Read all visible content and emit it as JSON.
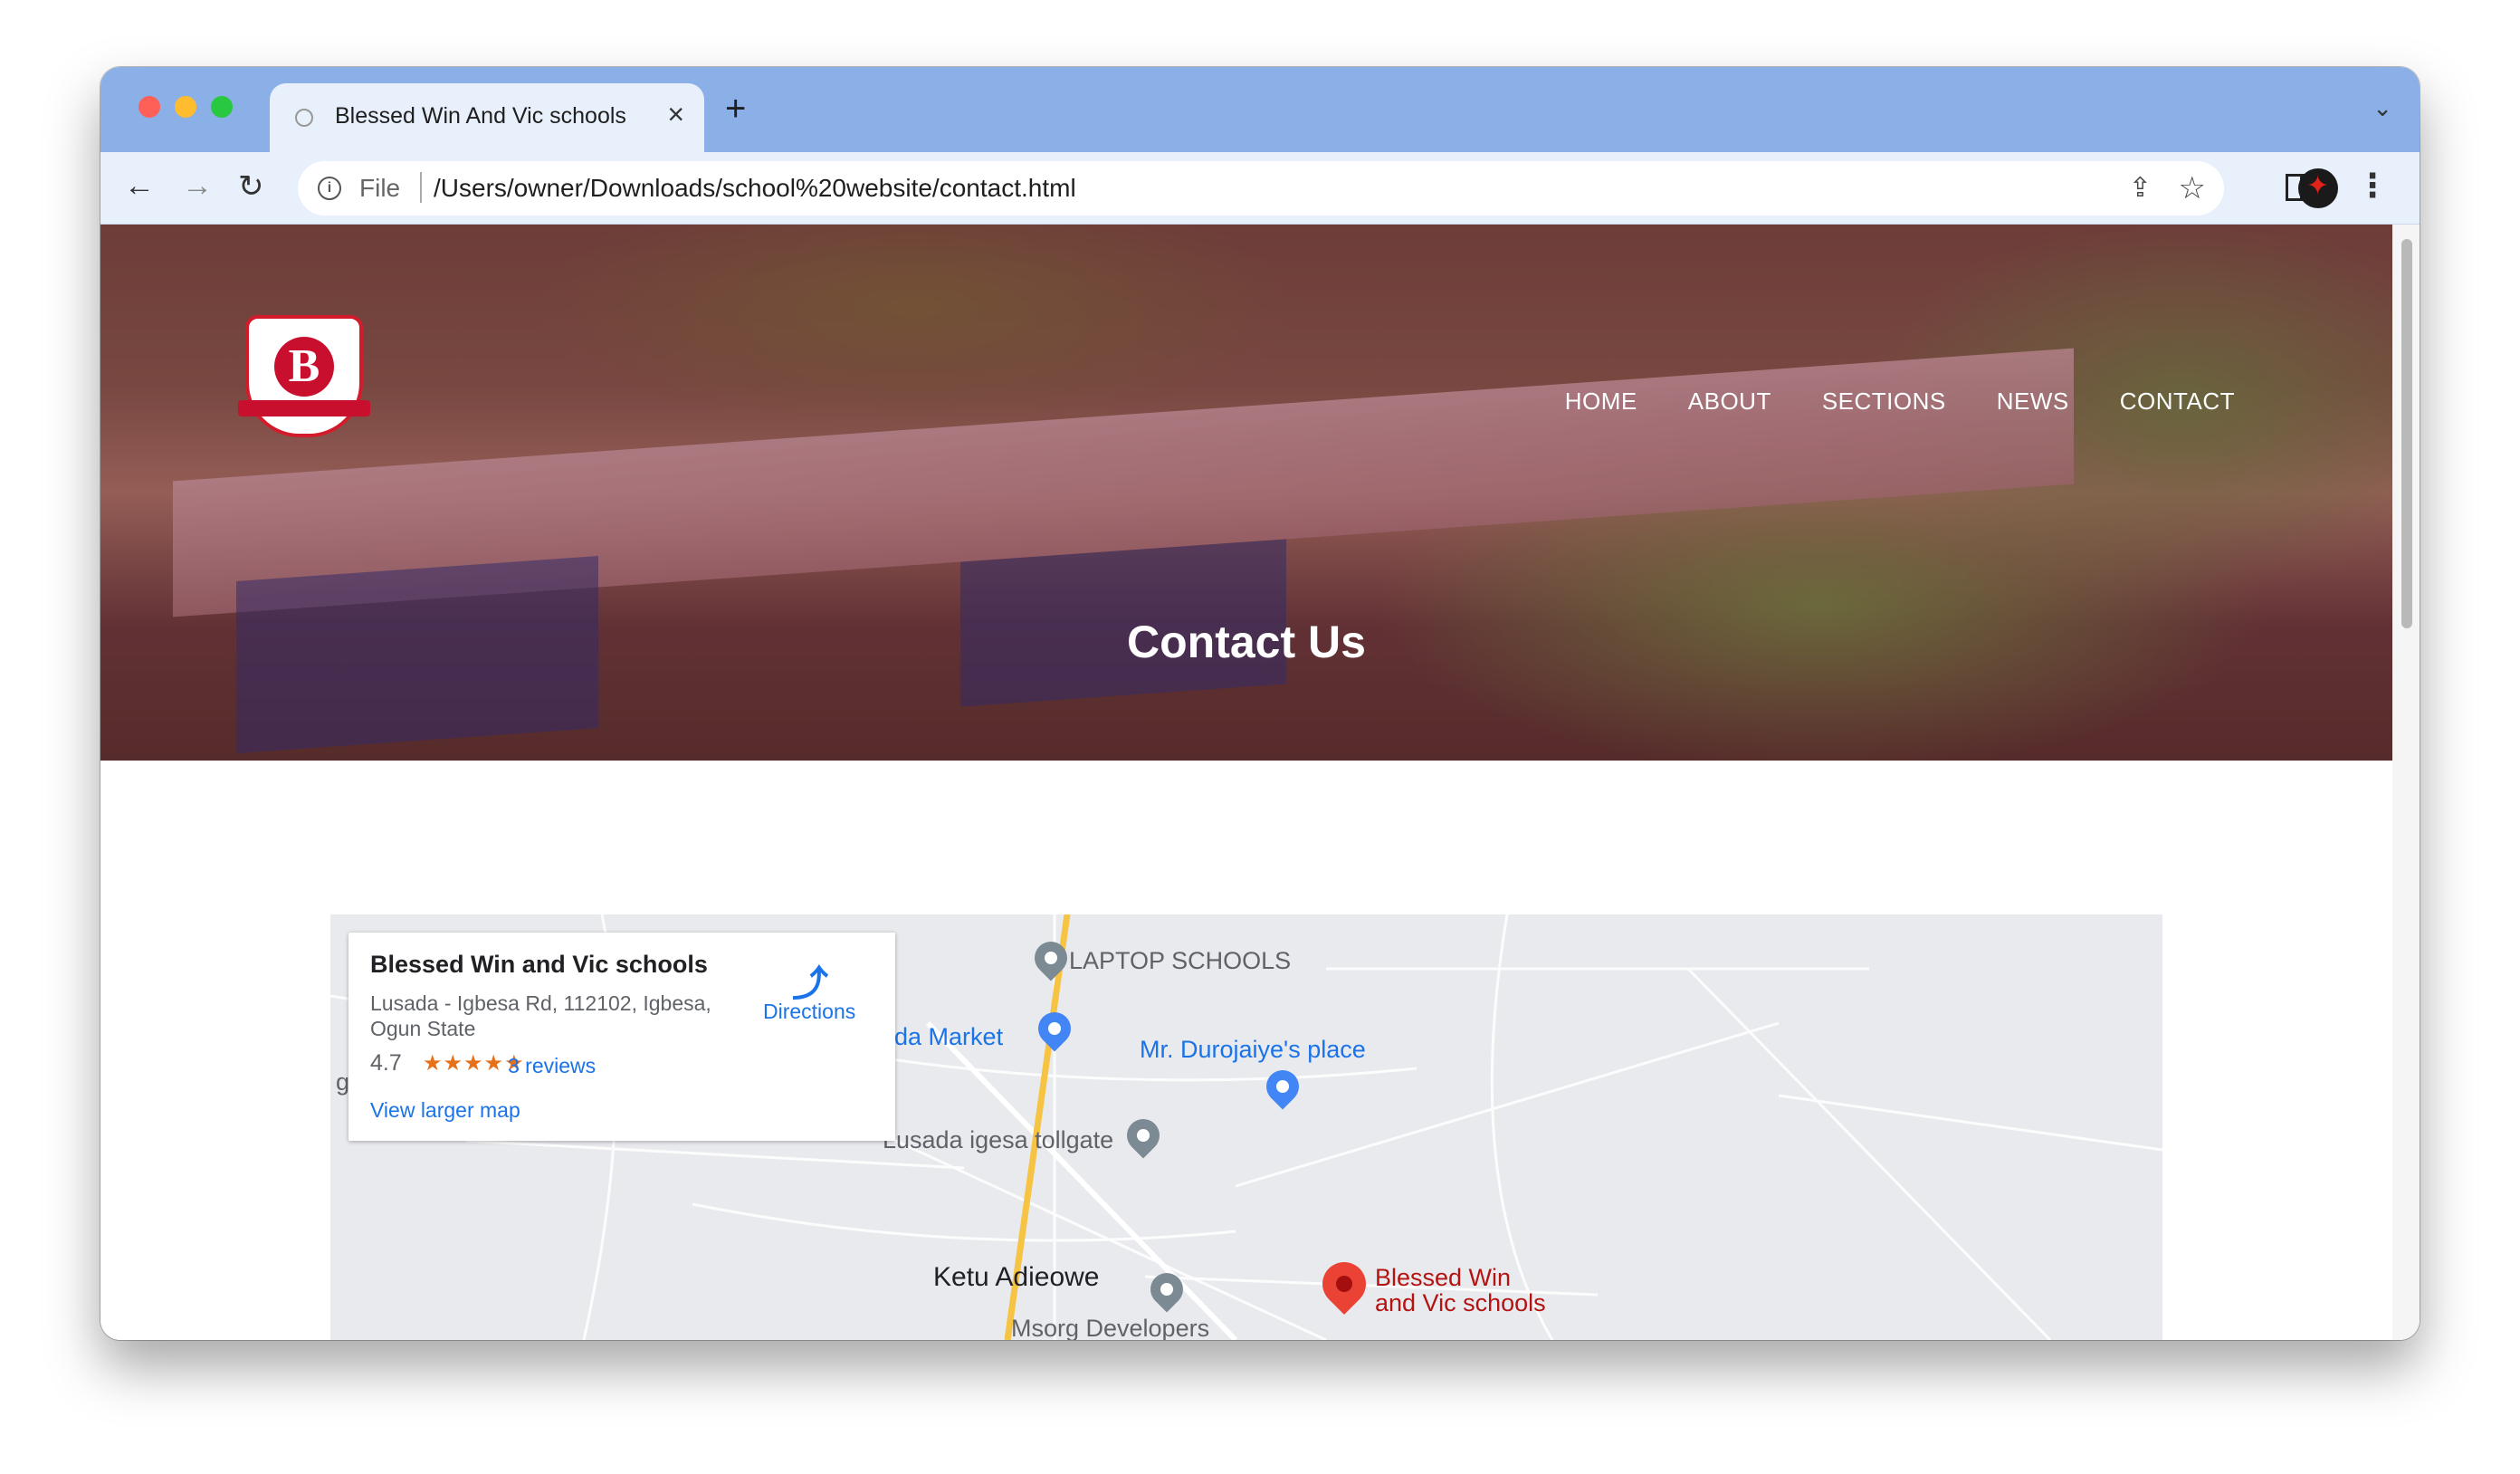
{
  "browser": {
    "tab_title": "Blessed Win And Vic schools",
    "url_scheme": "File",
    "url": "/Users/owner/Downloads/school%20website/contact.html",
    "icons": [
      "back-arrow-icon",
      "forward-arrow-icon",
      "reload-icon",
      "info-icon",
      "share-icon",
      "star-icon",
      "side-panel-icon",
      "profile-icon",
      "kebab-menu-icon"
    ]
  },
  "site": {
    "logo_letter": "B",
    "nav": [
      "HOME",
      "ABOUT",
      "SECTIONS",
      "NEWS",
      "CONTACT"
    ],
    "hero_title": "Contact Us"
  },
  "map": {
    "card": {
      "title": "Blessed Win and Vic schools",
      "address": "Lusada - Igbesa Rd, 112102, Igbesa, Ogun State",
      "rating": "4.7",
      "stars": "★★★★★",
      "reviews": "3 reviews",
      "directions": "Directions",
      "larger_map": "View larger map"
    },
    "labels": {
      "laptop_schools": "LAPTOP SCHOOLS",
      "market": "ada Market",
      "durojaiye": "Mr. Durojaiye's place",
      "tollgate": "Lusada igesa tollgate",
      "ketu": "Ketu Adieowe",
      "school_line1": "Blessed Win",
      "school_line2": "and Vic schools",
      "msorg": "Msorg Developers",
      "edge_g": "g"
    },
    "colors": {
      "road_main": "#f6c343",
      "pin_school": "#ea4335",
      "link": "#1a73e8"
    }
  }
}
